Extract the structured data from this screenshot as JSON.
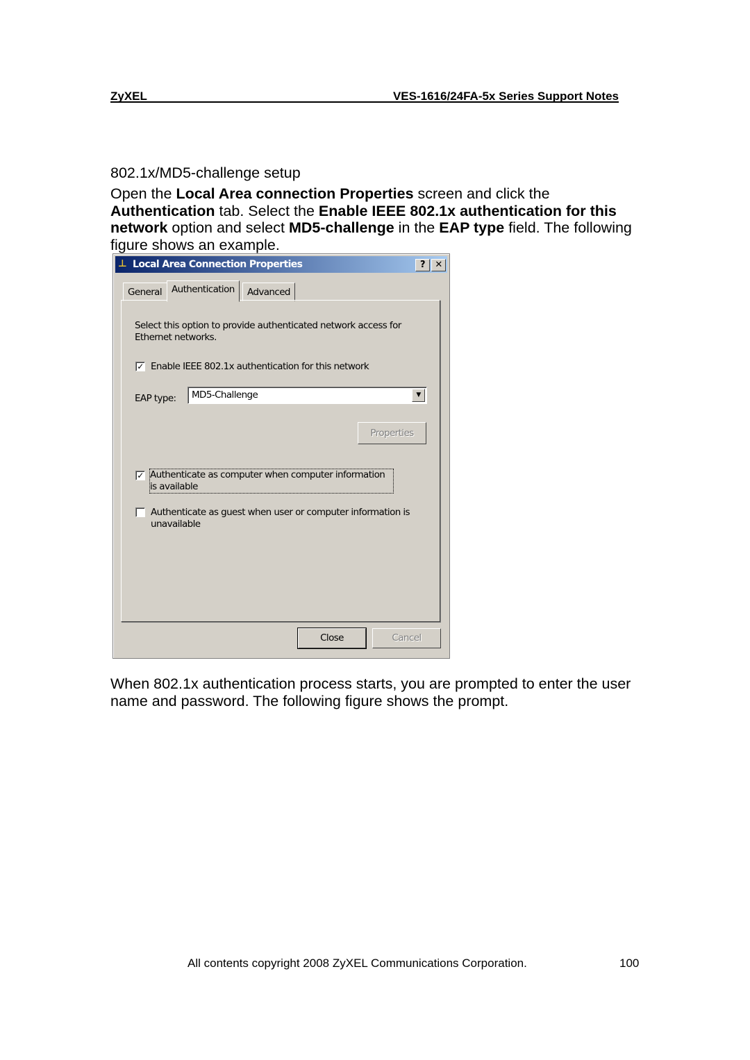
{
  "header": {
    "left": "ZyXEL",
    "right": "VES-1616/24FA-5x Series Support Notes"
  },
  "section_title": "802.1x/MD5-challenge setup",
  "intro": [
    {
      "t": "Open the ",
      "b": false
    },
    {
      "t": "Local Area connection Properties",
      "b": true
    },
    {
      "t": " screen and click the ",
      "b": false
    },
    {
      "t": "Authentication",
      "b": true
    },
    {
      "t": " tab. Select the ",
      "b": false
    },
    {
      "t": "Enable IEEE 802.1x authentication for this network",
      "b": true
    },
    {
      "t": " option and select ",
      "b": false
    },
    {
      "t": "MD5-challenge",
      "b": true
    },
    {
      "t": " in the ",
      "b": false
    },
    {
      "t": "EAP type",
      "b": true
    },
    {
      "t": " field. The following figure shows an example.",
      "b": false
    }
  ],
  "dialog": {
    "title": "Local Area Connection Properties",
    "help_label": "?",
    "close_label": "✕",
    "tabs": [
      "General",
      "Authentication",
      "Advanced"
    ],
    "active_tab": "Authentication",
    "description": "Select this option to provide authenticated network access for Ethernet networks.",
    "enable_8021x": {
      "label": "Enable IEEE 802.1x authentication for this network",
      "checked": true
    },
    "eap_type": {
      "label": "EAP type:",
      "value": "MD5-Challenge"
    },
    "properties_button": "Properties",
    "auth_computer": {
      "label": "Authenticate as computer when computer information is available",
      "checked": true
    },
    "auth_guest": {
      "label": "Authenticate as guest when user or computer information is unavailable",
      "checked": false
    },
    "close_button": "Close",
    "cancel_button": "Cancel"
  },
  "after_text": "When 802.1x authentication process starts, you are prompted to enter the user name and password. The following figure shows the prompt.",
  "footer": {
    "copyright": "All contents copyright 2008 ZyXEL Communications Corporation.",
    "page": "100"
  }
}
